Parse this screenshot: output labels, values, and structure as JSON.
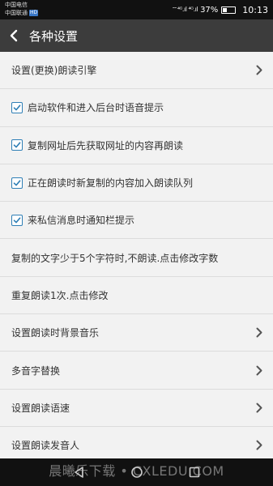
{
  "status_bar": {
    "carrier_1": "中国电信",
    "carrier_2": "中国联通",
    "hd_badge": "HD",
    "network_icons": "⌔⁴ᴳ.ıl ⁴ᴳ.ıl",
    "battery_text": "37%",
    "battery_level": 0.37,
    "time": "10:13"
  },
  "app_bar": {
    "title": "各种设置",
    "back_icon": "chevron-left-icon"
  },
  "settings": [
    {
      "label": "设置(更换)朗读引擎",
      "type": "nav"
    },
    {
      "label": "启动软件和进入后台时语音提示",
      "type": "checkbox",
      "checked": true
    },
    {
      "label": "复制网址后先获取网址的内容再朗读",
      "type": "checkbox",
      "checked": true
    },
    {
      "label": "正在朗读时新复制的内容加入朗读队列",
      "type": "checkbox",
      "checked": true
    },
    {
      "label": "来私信消息时通知栏提示",
      "type": "checkbox",
      "checked": true
    },
    {
      "label": "复制的文字少于5个字符时,不朗读.点击修改字数",
      "type": "text"
    },
    {
      "label": "重复朗读1次.点击修改",
      "type": "text"
    },
    {
      "label": "设置朗读时背景音乐",
      "type": "nav"
    },
    {
      "label": "多音字替换",
      "type": "nav"
    },
    {
      "label": "设置朗读语速",
      "type": "nav"
    },
    {
      "label": "设置朗读发音人",
      "type": "nav"
    }
  ],
  "watermark": "晨曦乐下载 • CXLEDU.COM",
  "colors": {
    "app_bar": "#3c3c3c",
    "accent": "#2f7fb6",
    "background": "#f2f2f2"
  }
}
